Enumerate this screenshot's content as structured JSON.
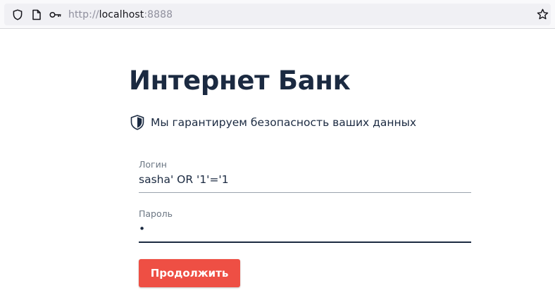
{
  "browser": {
    "url_protocol": "http://",
    "url_host": "localhost",
    "url_port": ":8888",
    "icons": [
      "shield-icon",
      "page-icon",
      "key-icon",
      "bookmark-star-icon"
    ]
  },
  "page": {
    "title": "Интернет Банк",
    "security_note": "Мы гарантируем безопасность ваших данных",
    "security_icon": "shield-icon"
  },
  "form": {
    "login": {
      "label": "Логин",
      "value": "sasha' OR '1'='1"
    },
    "password": {
      "label": "Пароль",
      "value": "•"
    },
    "submit_label": "Продолжить"
  },
  "colors": {
    "title": "#1b2a41",
    "button": "#ee4f44",
    "button_text": "#ffffff",
    "label": "#6b7683"
  }
}
